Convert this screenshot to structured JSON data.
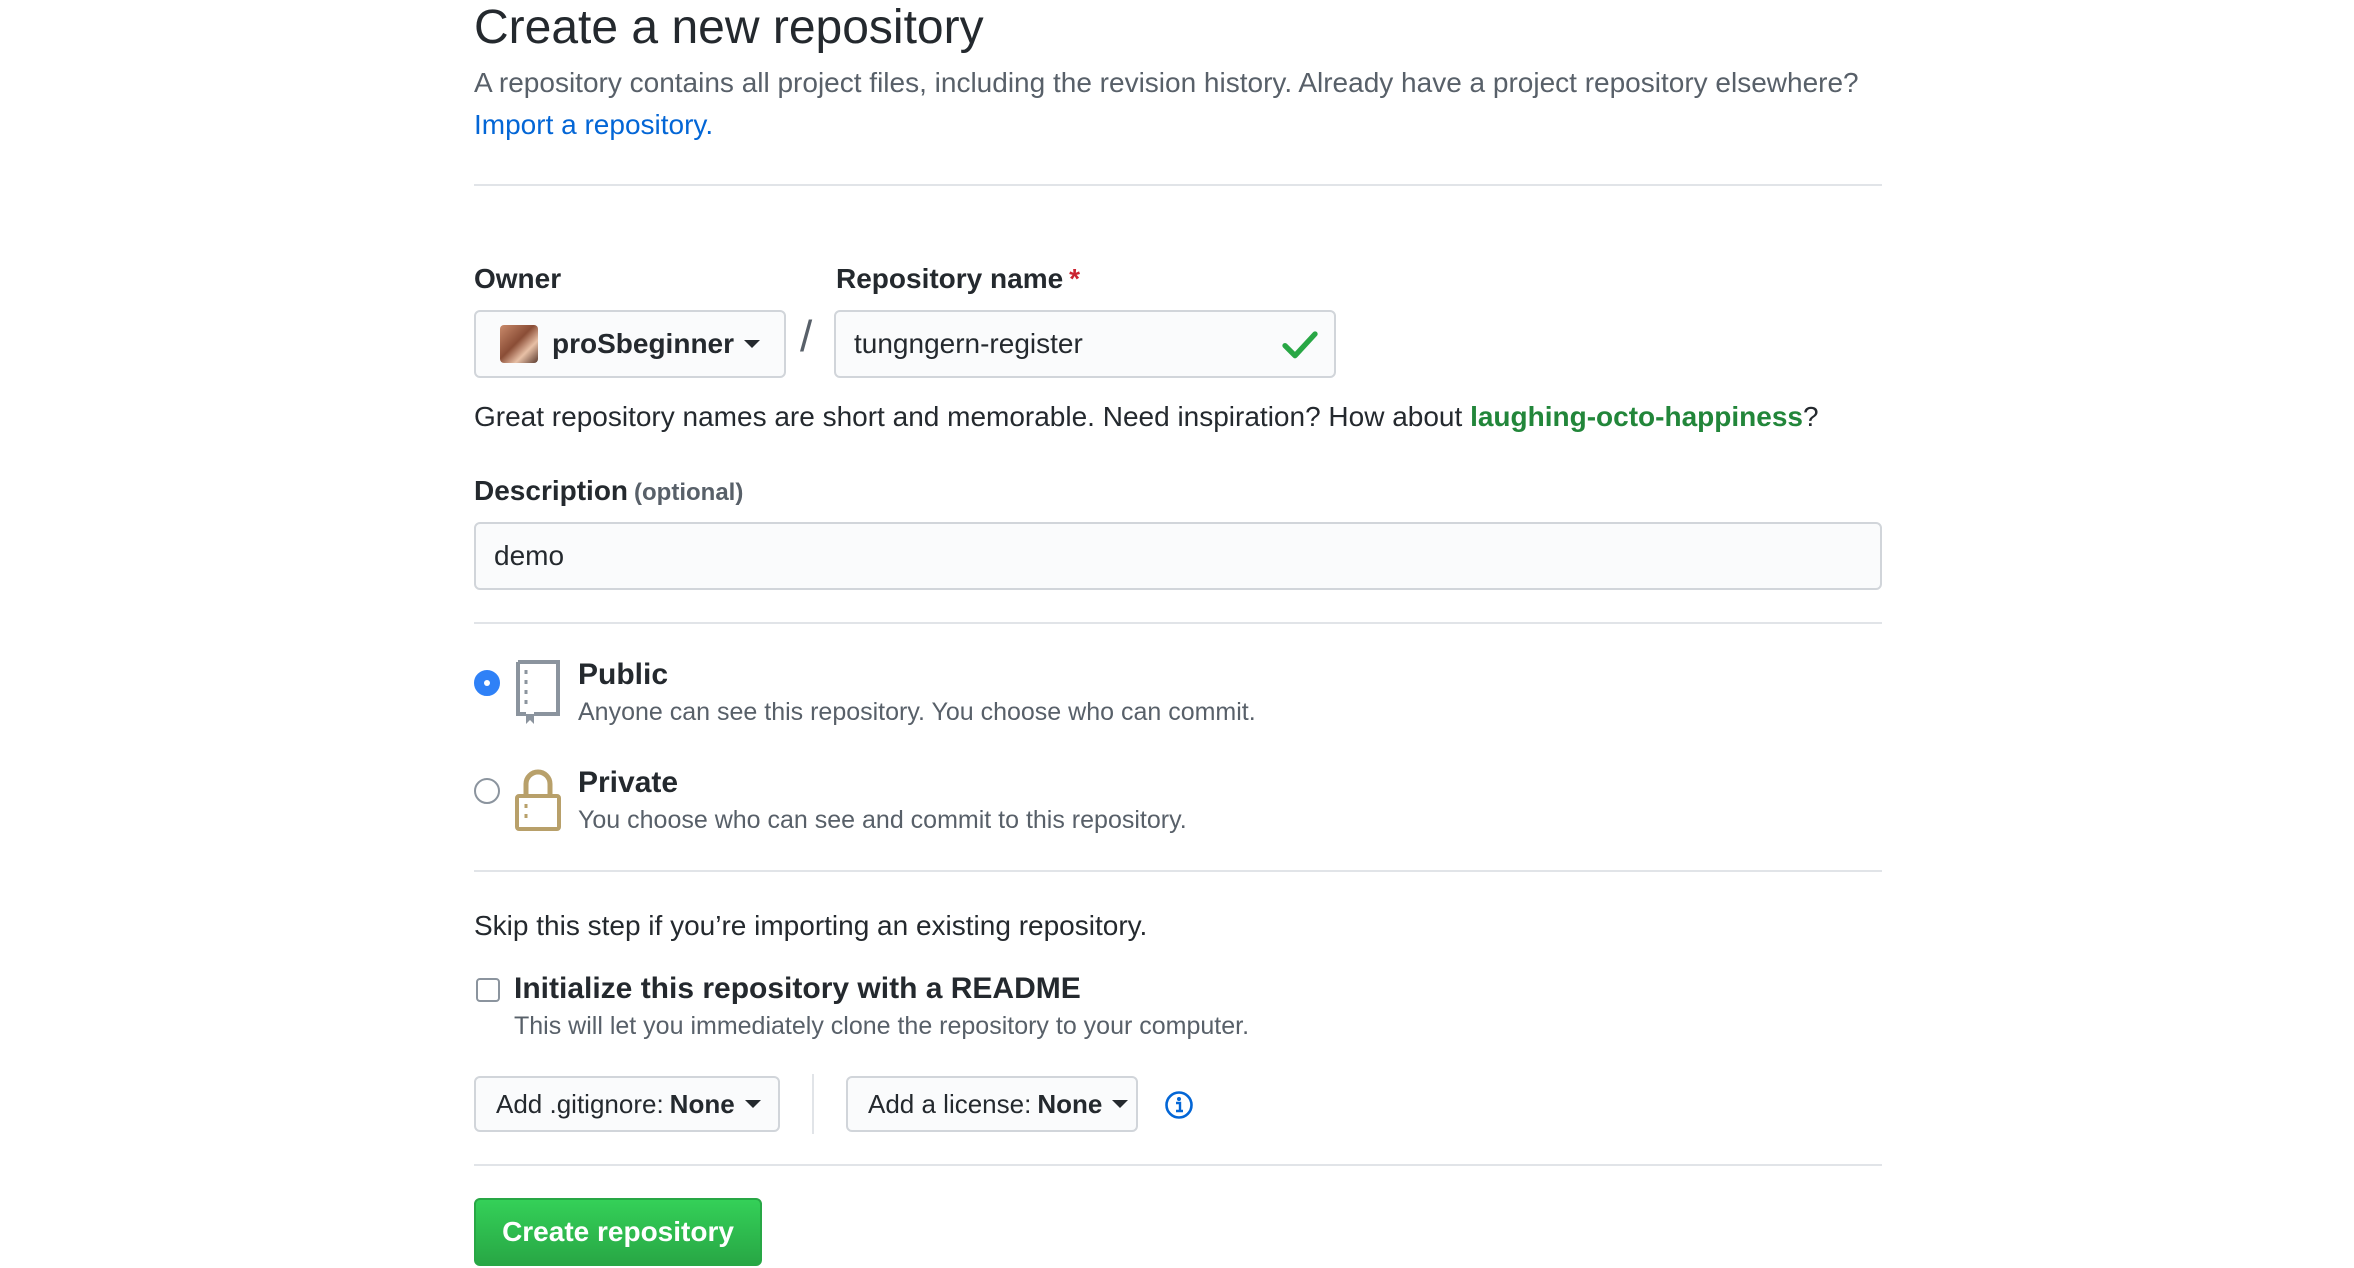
{
  "header": {
    "title": "Create a new repository",
    "subtitle": "A repository contains all project files, including the revision history. Already have a project repository elsewhere?",
    "import_link": "Import a repository."
  },
  "owner": {
    "label": "Owner",
    "value": "proSbeginner"
  },
  "repo_name": {
    "label": "Repository name",
    "required_mark": "*",
    "separator": "/",
    "value": "tungngern-register"
  },
  "hint": {
    "text": "Great repository names are short and memorable. Need inspiration? How about",
    "suggestion": "laughing-octo-happiness",
    "end": "?"
  },
  "description": {
    "label": "Description",
    "optional": "(optional)",
    "value": "demo"
  },
  "visibility": {
    "selected": "public",
    "public": {
      "title": "Public",
      "desc": "Anyone can see this repository. You choose who can commit."
    },
    "private": {
      "title": "Private",
      "desc": "You choose who can see and commit to this repository."
    }
  },
  "init": {
    "skip_text": "Skip this step if you’re importing an existing repository.",
    "readme_label": "Initialize this repository with a README",
    "readme_desc": "This will let you immediately clone the repository to your computer.",
    "readme_checked": false
  },
  "gitignore": {
    "label": "Add .gitignore:",
    "value": "None"
  },
  "license": {
    "label": "Add a license:",
    "value": "None"
  },
  "submit": {
    "label": "Create repository"
  },
  "colors": {
    "link": "#0366d6",
    "suggestion": "#22863a",
    "primary_button": "#28a745",
    "radio_selected": "#2f81f7",
    "required": "#cb2431",
    "lock_icon": "#b8a06a"
  }
}
